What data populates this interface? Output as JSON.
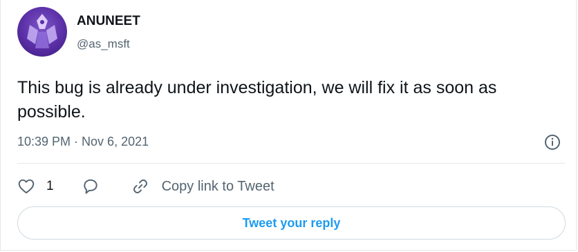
{
  "user": {
    "display_name": "ANUNEET",
    "handle": "@as_msft",
    "avatar_icon": "purple-logo-avatar"
  },
  "tweet": {
    "text": "This bug is already under investigation, we will fix it as soon as possible.",
    "timestamp": "10:39 PM · Nov 6, 2021"
  },
  "actions": {
    "like_count": "1",
    "copy_link_label": "Copy link to Tweet",
    "tweet_reply_label": "Tweet your reply"
  },
  "colors": {
    "accent": "#1d9bf0",
    "secondary_text": "#536471",
    "avatar_bg": "#5a2ea6"
  }
}
